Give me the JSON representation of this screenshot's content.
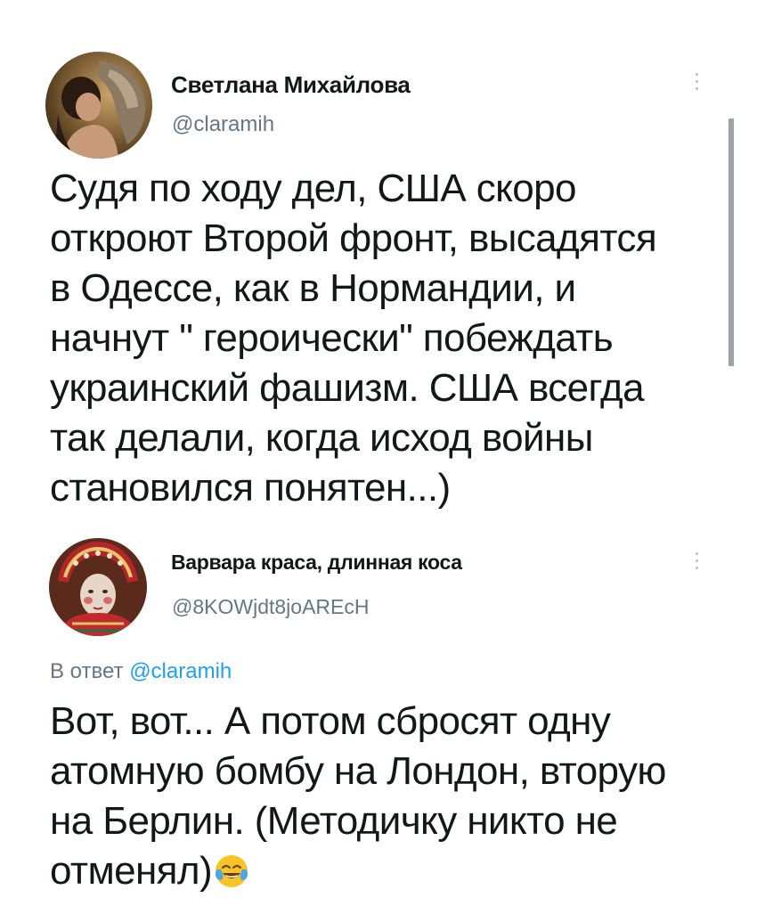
{
  "tweets": [
    {
      "author": {
        "display_name": "Светлана Михайлова",
        "handle": "@claramih",
        "avatar": "avatar-woman-with-wolf"
      },
      "text_lines": [
        "Судя по ходу дел, США скоро",
        "откроют Второй фронт, высадятся",
        "в Одессе, как в Нормандии, и",
        "начнут \" героически\" побеждать",
        "украинский фашизм. США всегда",
        "так делали, когда исход войны",
        "становился понятен...)"
      ]
    },
    {
      "author": {
        "display_name": "Варвара краса, длинная коса",
        "handle": "@8KOWjdt8joAREcH",
        "avatar": "avatar-woman-in-kokoshnik"
      },
      "reply_to": {
        "prefix": "В ответ",
        "mention": "@claramih"
      },
      "text_lines": [
        "Вот, вот... А потом сбросят одну",
        "атомную бомбу на Лондон, вторую",
        "на Берлин. (Методичку никто не",
        "отменял)"
      ],
      "trailing_emoji": "face-with-tears-of-joy"
    }
  ],
  "icons": {
    "more": "vertical-dots-icon"
  },
  "colors": {
    "text": "#14171a",
    "secondary": "#657786",
    "link": "#1da1f2",
    "scrollbar": "#9ca3a9"
  }
}
